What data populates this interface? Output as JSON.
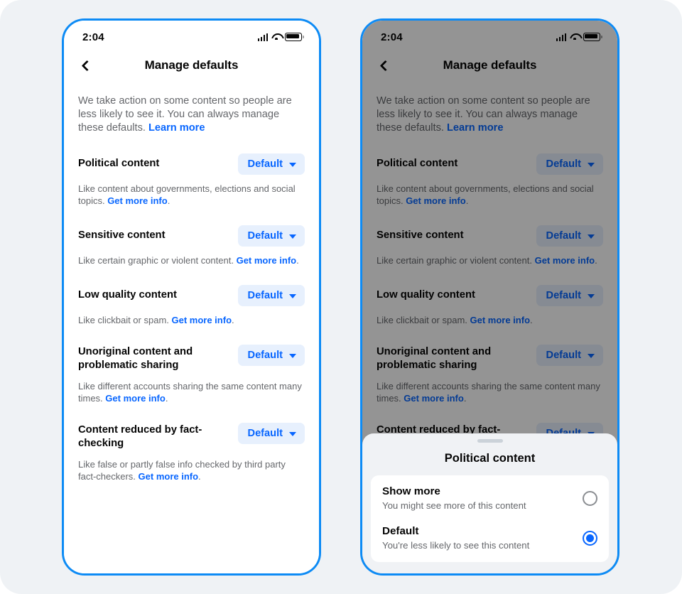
{
  "colors": {
    "page_background": "#eff2f5",
    "phone_border": "#0d8bf5",
    "accent_blue": "#0866ff",
    "pill_background": "#e7f0fd",
    "text_primary": "#050505",
    "text_secondary": "#65676b",
    "sheet_background": "#f0f2f5",
    "scrim": "rgba(0,0,0,0.42)"
  },
  "status_bar": {
    "time": "2:04",
    "signal_icon": "cellular-signal-icon",
    "wifi_icon": "wifi-icon",
    "battery_icon": "battery-icon"
  },
  "nav": {
    "back_icon": "back-chevron-icon",
    "title": "Manage defaults"
  },
  "intro": {
    "text": "We take action on some content so people are less likely to see it. You can always manage these defaults. ",
    "link_label": "Learn more"
  },
  "settings": [
    {
      "title": "Political content",
      "button_label": "Default",
      "desc_before": "Like content about governments, elections and social topics. ",
      "desc_link": "Get more info",
      "desc_after": ".",
      "two_line": false
    },
    {
      "title": "Sensitive content",
      "button_label": "Default",
      "desc_before": "Like certain graphic or violent content. ",
      "desc_link": "Get more info",
      "desc_after": ".",
      "two_line": false
    },
    {
      "title": "Low quality content",
      "button_label": "Default",
      "desc_before": "Like clickbait or spam. ",
      "desc_link": "Get more info",
      "desc_after": ".",
      "two_line": false
    },
    {
      "title": "Unoriginal content and problematic sharing",
      "button_label": "Default",
      "desc_before": "Like different accounts sharing the same content many times. ",
      "desc_link": "Get more info",
      "desc_after": ".",
      "two_line": true
    },
    {
      "title": "Content reduced by fact-checking",
      "button_label": "Default",
      "desc_before": "Like false or partly false info checked by third party fact-checkers. ",
      "desc_link": "Get more info",
      "desc_after": ".",
      "two_line": true
    }
  ],
  "sheet": {
    "handle": "drag-handle",
    "title": "Political content",
    "options": [
      {
        "title": "Show more",
        "subtitle": "You might see more of this content",
        "selected": false
      },
      {
        "title": "Default",
        "subtitle": "You're less likely to see this content",
        "selected": true
      }
    ]
  }
}
